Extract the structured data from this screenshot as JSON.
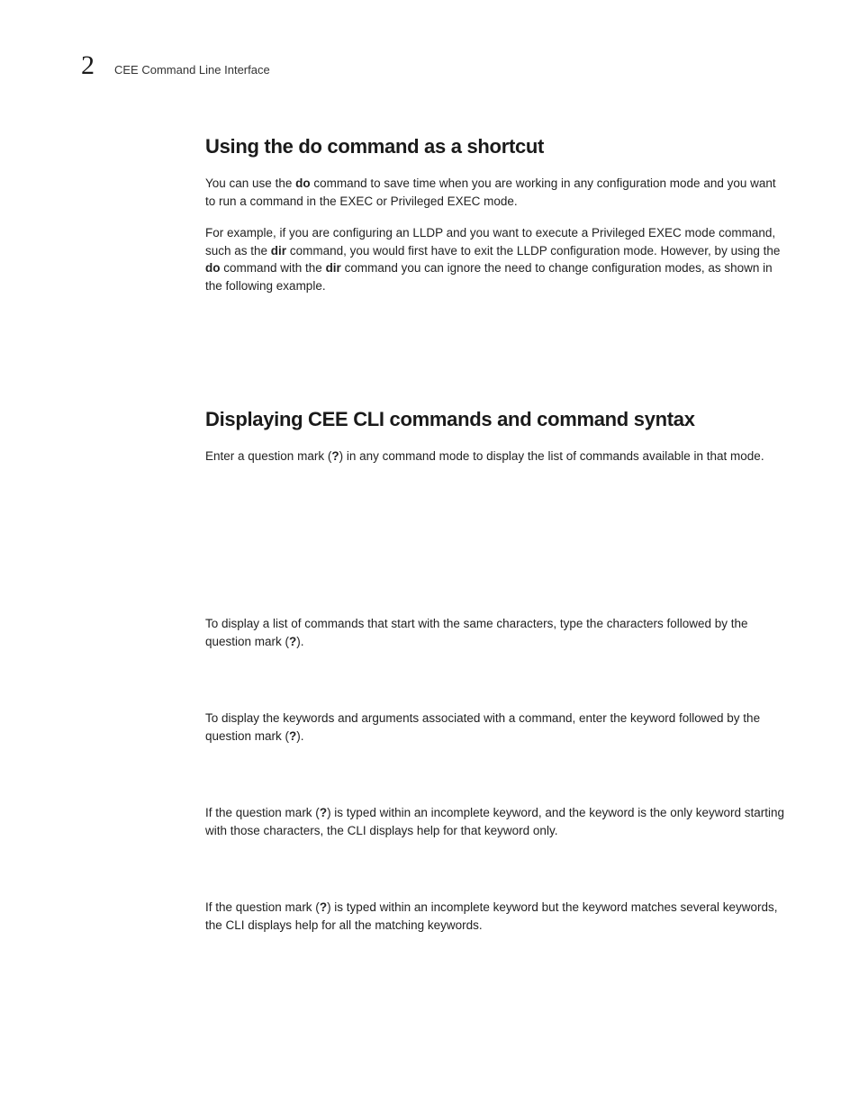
{
  "header": {
    "chapter_number": "2",
    "chapter_title": "CEE Command Line Interface"
  },
  "section1": {
    "heading": "Using the do command as a shortcut",
    "p1_a": "You can use the ",
    "p1_b": "do",
    "p1_c": " command to save time when you are working in any configuration mode and you want to run a command in the EXEC or Privileged EXEC mode.",
    "p2_a": "For example, if you are configuring an LLDP and you want to execute a Privileged EXEC mode command, such as the ",
    "p2_b": "dir",
    "p2_c": " command, you would first have to exit the LLDP configuration mode. However, by using the ",
    "p2_d": "do",
    "p2_e": " command with the ",
    "p2_f": "dir",
    "p2_g": " command you can ignore the need to change configuration modes, as shown in the following example."
  },
  "section2": {
    "heading": "Displaying CEE CLI commands and command syntax",
    "p1_a": "Enter a question mark (",
    "p1_b": "?",
    "p1_c": ") in any command mode to display the list of commands available in that mode.",
    "p2_a": "To display a list of commands that start with the same characters, type the characters followed by the question mark (",
    "p2_b": "?",
    "p2_c": ").",
    "p3_a": "To display the keywords and arguments associated with a command, enter the keyword followed by the question mark (",
    "p3_b": "?",
    "p3_c": ").",
    "p4_a": "If the question mark (",
    "p4_b": "?",
    "p4_c": ") is typed within an incomplete keyword, and the keyword is the only keyword starting with those characters, the CLI displays help for that keyword only.",
    "p5_a": "If the question mark (",
    "p5_b": "?",
    "p5_c": ") is typed within an incomplete keyword but the keyword matches several keywords, the CLI displays help for all the matching keywords."
  }
}
